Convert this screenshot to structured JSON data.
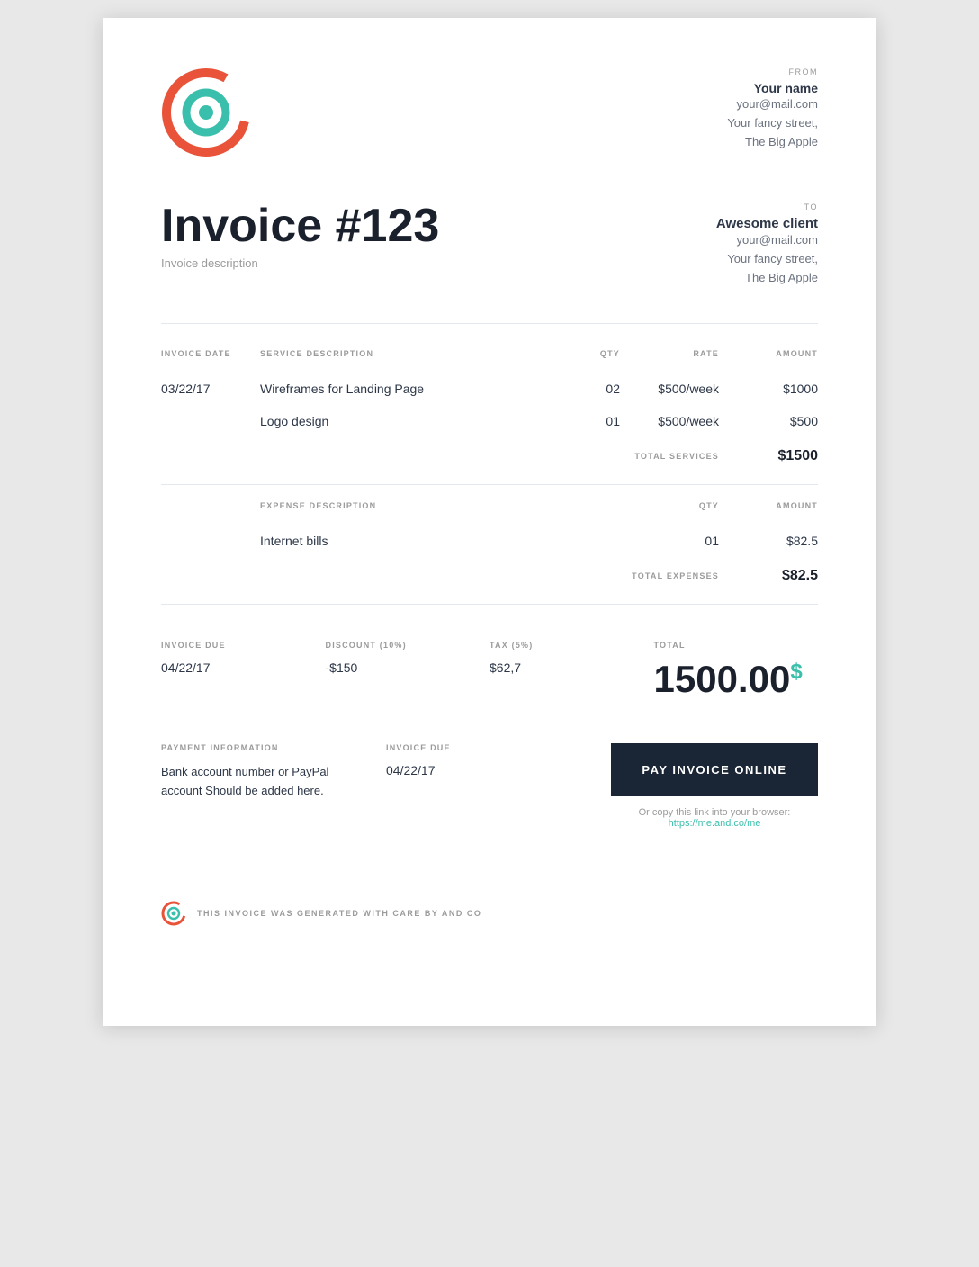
{
  "from": {
    "label": "FROM",
    "name": "Your name",
    "email": "your@mail.com",
    "street": "Your fancy street,",
    "city": "The Big Apple"
  },
  "to": {
    "label": "TO",
    "name": "Awesome client",
    "email": "your@mail.com",
    "street": "Your fancy street,",
    "city": "The Big Apple"
  },
  "invoice": {
    "title": "Invoice #123",
    "description": "Invoice description"
  },
  "table": {
    "headers": {
      "invoice_date": "INVOICE DATE",
      "service_desc": "SERVICE DESCRIPTION",
      "qty": "QTY",
      "rate": "RATE",
      "amount": "AMOUNT"
    },
    "invoice_date": "03/22/17",
    "services": [
      {
        "description": "Wireframes for Landing Page",
        "qty": "02",
        "rate": "$500/week",
        "amount": "$1000"
      },
      {
        "description": "Logo design",
        "qty": "01",
        "rate": "$500/week",
        "amount": "$500"
      }
    ],
    "total_services_label": "TOTAL SERVICES",
    "total_services": "$1500"
  },
  "expenses": {
    "headers": {
      "expense_desc": "EXPENSE DESCRIPTION",
      "qty": "QTY",
      "amount": "AMOUNT"
    },
    "items": [
      {
        "description": "Internet bills",
        "qty": "01",
        "amount": "$82.5"
      }
    ],
    "total_expenses_label": "TOTAL EXPENSES",
    "total_expenses": "$82.5"
  },
  "totals": {
    "invoice_due_label": "INVOICE DUE",
    "invoice_due": "04/22/17",
    "discount_label": "DISCOUNT (10%)",
    "discount": "-$150",
    "tax_label": "TAX (5%)",
    "tax": "$62,7",
    "total_label": "TOTAL",
    "total_main": "1500.00",
    "total_currency": "$"
  },
  "payment": {
    "info_label": "PAYMENT INFORMATION",
    "info_text": "Bank account number or PayPal account Should be added here.",
    "due_label": "INVOICE DUE",
    "due_date": "04/22/17",
    "pay_button": "PAY INVOICE ONLINE",
    "link_text": "Or copy this link into your browser:",
    "link_url": "https://me.and.co/me",
    "link_display": "https://me.and.co/me"
  },
  "footer": {
    "text": "THIS INVOICE WAS GENERATED WITH CARE BY AND CO"
  }
}
